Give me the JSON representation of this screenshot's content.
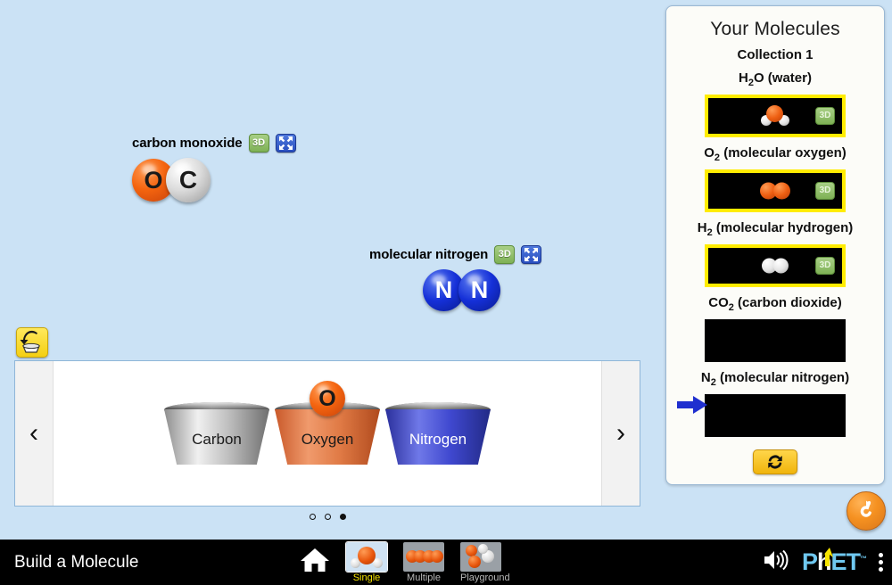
{
  "app": {
    "title": "Build a Molecule",
    "background_color": "#cbe2f5"
  },
  "play_area": {
    "molecules": [
      {
        "name": "carbon monoxide",
        "view_3d_label": "3D",
        "break_label": "break-apart",
        "atoms": [
          {
            "symbol": "O",
            "element": "oxygen",
            "color": "#f4640f"
          },
          {
            "symbol": "C",
            "element": "carbon",
            "color": "#dcdcdc"
          }
        ]
      },
      {
        "name": "molecular nitrogen",
        "view_3d_label": "3D",
        "break_label": "break-apart",
        "atoms": [
          {
            "symbol": "N",
            "element": "nitrogen",
            "color": "#1530d8"
          },
          {
            "symbol": "N",
            "element": "nitrogen",
            "color": "#1530d8"
          }
        ]
      }
    ],
    "return_button_label": "return atoms to kit"
  },
  "kit": {
    "prev_label": "‹",
    "next_label": "›",
    "buckets": [
      {
        "label": "Carbon",
        "element": "C",
        "color": "#bdbdbd",
        "atom_visible": false
      },
      {
        "label": "Oxygen",
        "element": "O",
        "color": "#e07a45",
        "atom_visible": true,
        "atom_symbol": "O"
      },
      {
        "label": "Nitrogen",
        "element": "N",
        "color": "#3f48cf",
        "atom_visible": false
      }
    ],
    "page_dots": [
      {
        "filled": false
      },
      {
        "filled": false
      },
      {
        "filled": true
      }
    ]
  },
  "collection": {
    "panel_title": "Your Molecules",
    "collection_name": "Collection 1",
    "refresh_label": "new collection",
    "items": [
      {
        "formula_html": "H<sub>2</sub>O (water)",
        "formula_text": "H2O (water)",
        "collected": true,
        "view_3d_label": "3D",
        "pointer": false
      },
      {
        "formula_html": "O<sub>2</sub> (molecular oxygen)",
        "formula_text": "O2 (molecular oxygen)",
        "collected": true,
        "view_3d_label": "3D",
        "pointer": false
      },
      {
        "formula_html": "H<sub>2</sub> (molecular hydrogen)",
        "formula_text": "H2 (molecular hydrogen)",
        "collected": true,
        "view_3d_label": "3D",
        "pointer": false
      },
      {
        "formula_html": "CO<sub>2</sub> (carbon dioxide)",
        "formula_text": "CO2 (carbon dioxide)",
        "collected": false,
        "view_3d_label": "",
        "pointer": false
      },
      {
        "formula_html": "N<sub>2</sub> (molecular nitrogen)",
        "formula_text": "N2 (molecular nitrogen)",
        "collected": false,
        "view_3d_label": "",
        "pointer": true
      }
    ]
  },
  "reset_all": {
    "label": "Reset All",
    "color": "#f59121"
  },
  "navbar": {
    "title": "Build a Molecule",
    "home_label": "Home",
    "screens": [
      {
        "label": "Single",
        "active": true
      },
      {
        "label": "Multiple",
        "active": false
      },
      {
        "label": "Playground",
        "active": false
      }
    ],
    "sound_label": "Sound",
    "logo": {
      "part1": "P",
      "part2": "h",
      "part3": "ET",
      "tm": "™"
    },
    "menu_label": "PhET Menu"
  }
}
